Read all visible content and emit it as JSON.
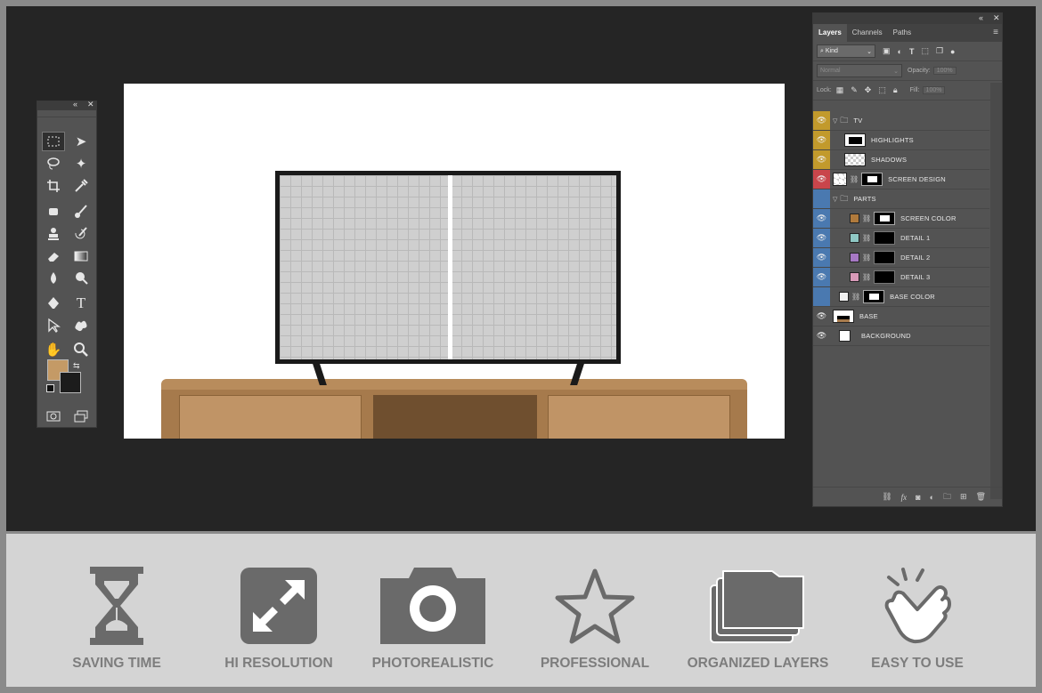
{
  "layers_panel": {
    "tabs": [
      "Layers",
      "Channels",
      "Paths"
    ],
    "filter_kind": "Kind",
    "blend_mode": "Normal",
    "opacity_label": "Opacity:",
    "opacity_value": "100%",
    "lock_label": "Lock:",
    "fill_label": "Fill:",
    "fill_value": "100%",
    "layers": [
      {
        "name": "TV",
        "eye": "gold",
        "type": "group"
      },
      {
        "name": "HIGHLIGHTS",
        "eye": "gold",
        "type": "layer"
      },
      {
        "name": "SHADOWS",
        "eye": "gold",
        "type": "layer"
      },
      {
        "name": "SCREEN DESIGN",
        "eye": "red",
        "type": "smart"
      },
      {
        "name": "PARTS",
        "eye": "blue",
        "type": "group"
      },
      {
        "name": "SCREEN COLOR",
        "eye": "blue",
        "type": "fill",
        "color": "#b07a3c"
      },
      {
        "name": "DETAIL 1",
        "eye": "blue",
        "type": "fill",
        "color": "#8fc8c4"
      },
      {
        "name": "DETAIL 2",
        "eye": "blue",
        "type": "fill",
        "color": "#a678c4"
      },
      {
        "name": "DETAIL 3",
        "eye": "blue",
        "type": "fill",
        "color": "#d89ab8"
      },
      {
        "name": "BASE COLOR",
        "eye": "blue",
        "type": "fill",
        "color": "#f2f2f2"
      },
      {
        "name": "BASE",
        "eye": "none",
        "type": "layer"
      },
      {
        "name": "BACKGROUND",
        "eye": "none",
        "type": "layer"
      }
    ]
  },
  "tools_panel": {
    "foreground_color": "#c49a66",
    "background_color": "#1c1c1c"
  },
  "features": [
    {
      "label": "SAVING TIME",
      "icon": "hourglass-icon"
    },
    {
      "label": "HI RESOLUTION",
      "icon": "expand-arrows-icon"
    },
    {
      "label": "PHOTOREALISTIC",
      "icon": "camera-icon"
    },
    {
      "label": "PROFESSIONAL",
      "icon": "star-icon"
    },
    {
      "label": "ORGANIZED LAYERS",
      "icon": "stacked-folders-icon"
    },
    {
      "label": "EASY TO USE",
      "icon": "tap-hand-icon"
    }
  ],
  "colors": {
    "workspace": "#252525",
    "panel": "#535353",
    "eye_gold": "#c29a2c",
    "eye_red": "#c9454b",
    "eye_blue": "#4a79b0",
    "feature_gray": "#7d7d7d"
  }
}
